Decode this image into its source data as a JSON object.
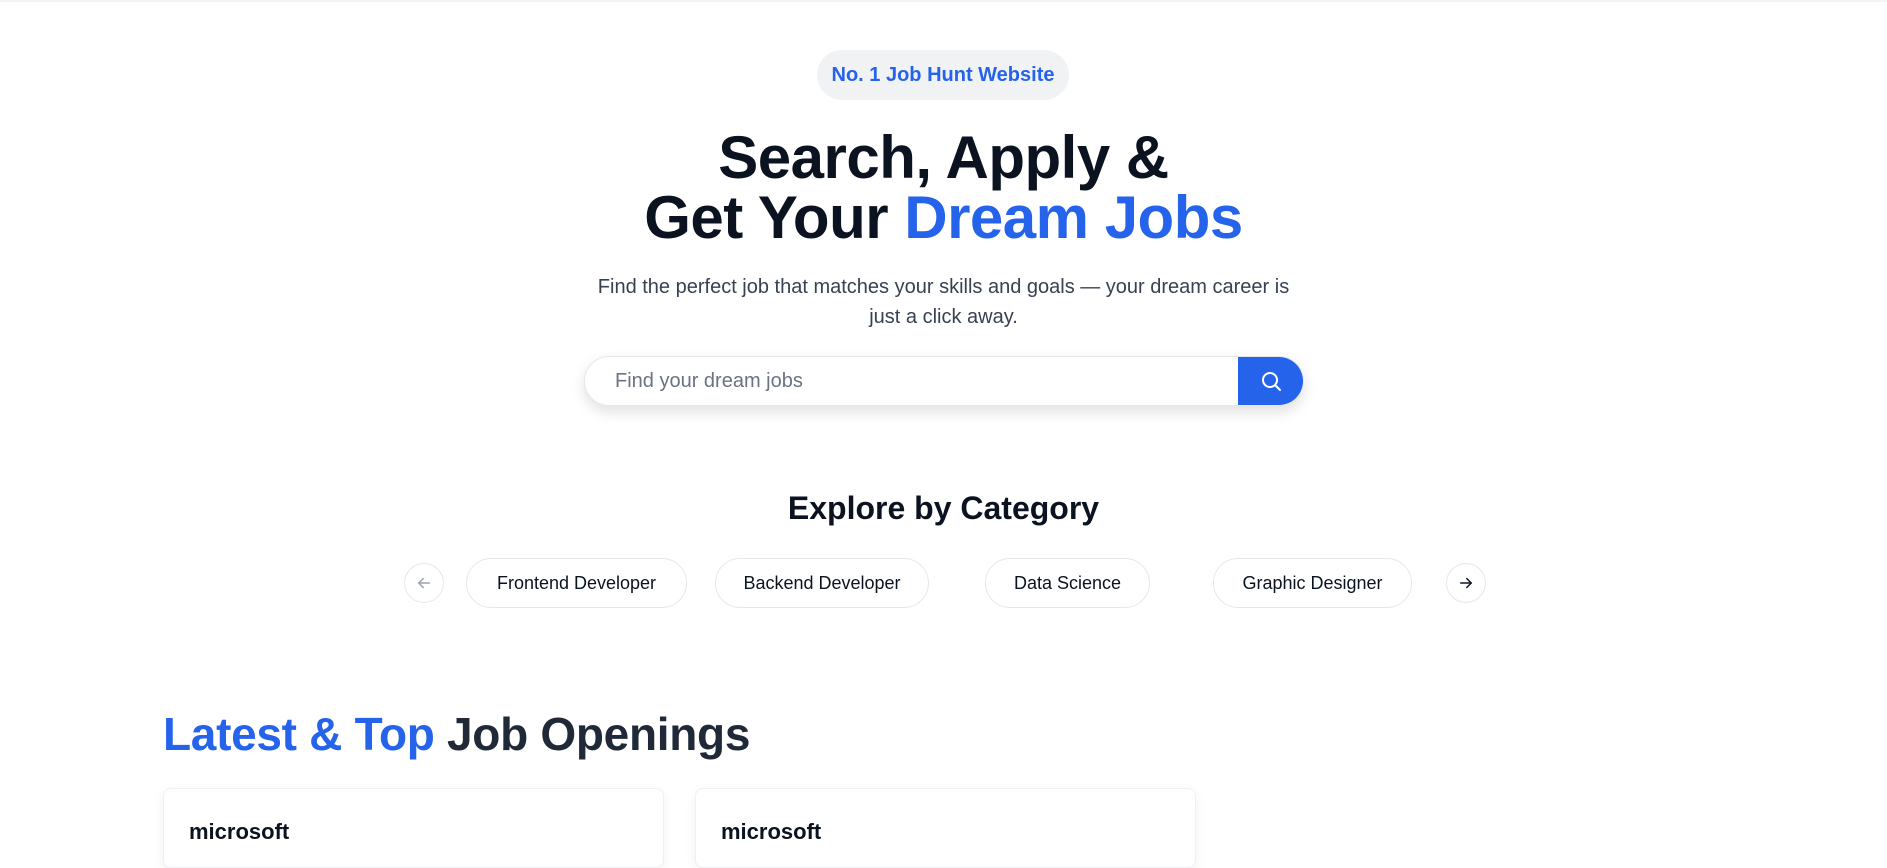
{
  "hero": {
    "badge": "No. 1 Job Hunt Website",
    "headline_line1": "Search, Apply &",
    "headline_line2_prefix": "Get Your ",
    "headline_line2_accent": "Dream Jobs",
    "subtitle": "Find the perfect job that matches your skills and goals — your dream career is just a click away."
  },
  "search": {
    "placeholder": "Find your dream jobs",
    "value": "",
    "button_icon": "search-icon"
  },
  "categories": {
    "title": "Explore by Category",
    "prev_icon": "arrow-left-icon",
    "next_icon": "arrow-right-icon",
    "items": [
      {
        "label": "Frontend Developer"
      },
      {
        "label": "Backend Developer"
      },
      {
        "label": "Data Science"
      },
      {
        "label": "Graphic Designer"
      }
    ]
  },
  "jobs": {
    "title_accent": "Latest & Top",
    "title_rest": " Job Openings",
    "cards": [
      {
        "company": "microsoft"
      },
      {
        "company": "microsoft"
      }
    ]
  },
  "colors": {
    "accent": "#2563eb",
    "heading": "#0b1220",
    "badge_bg": "#f1f2f4"
  }
}
